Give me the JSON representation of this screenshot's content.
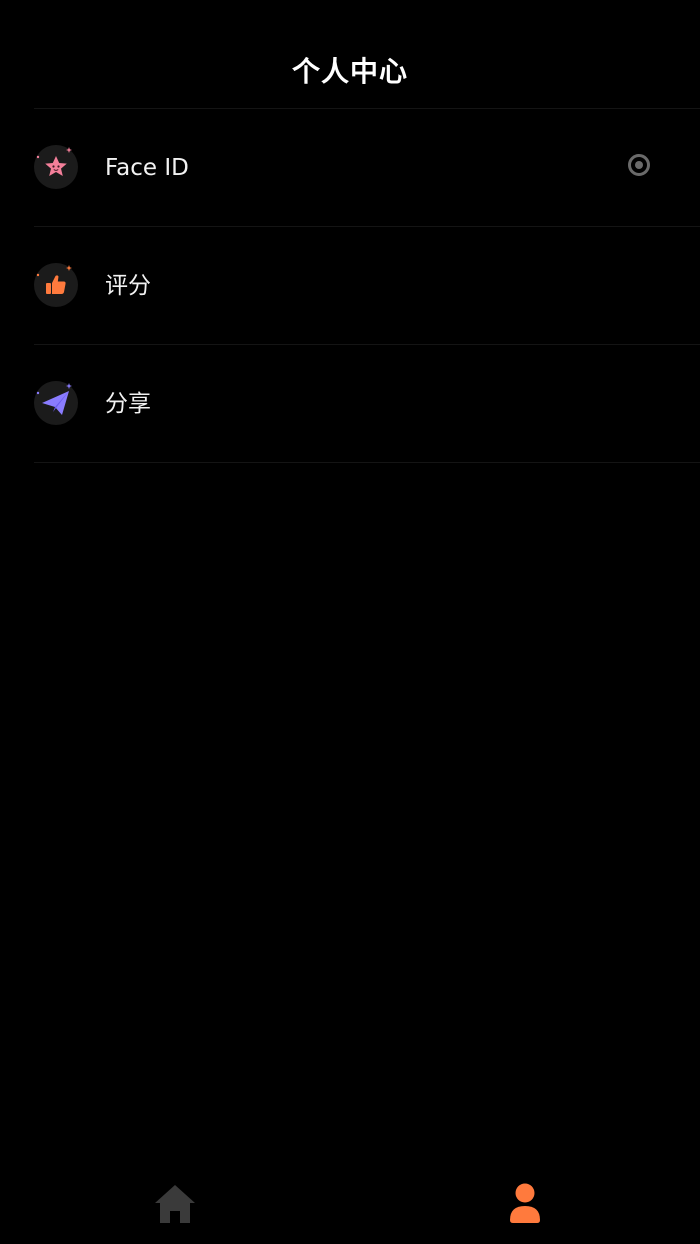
{
  "header": {
    "title": "个人中心"
  },
  "settings": {
    "items": [
      {
        "label": "Face ID",
        "icon": "star-face-icon",
        "icon_color": "#f47f9a",
        "has_toggle": true,
        "toggle_on": false
      },
      {
        "label": "评分",
        "icon": "thumbs-up-icon",
        "icon_color": "#ff7a3d",
        "has_toggle": false
      },
      {
        "label": "分享",
        "icon": "paper-plane-icon",
        "icon_color": "#8a7cff",
        "has_toggle": false
      }
    ]
  },
  "tabbar": {
    "tabs": [
      {
        "name": "home",
        "icon": "home-icon",
        "active": false
      },
      {
        "name": "profile",
        "icon": "person-icon",
        "active": true
      }
    ],
    "active_color": "#ff7a3d",
    "inactive_color": "#3a3a3a"
  }
}
